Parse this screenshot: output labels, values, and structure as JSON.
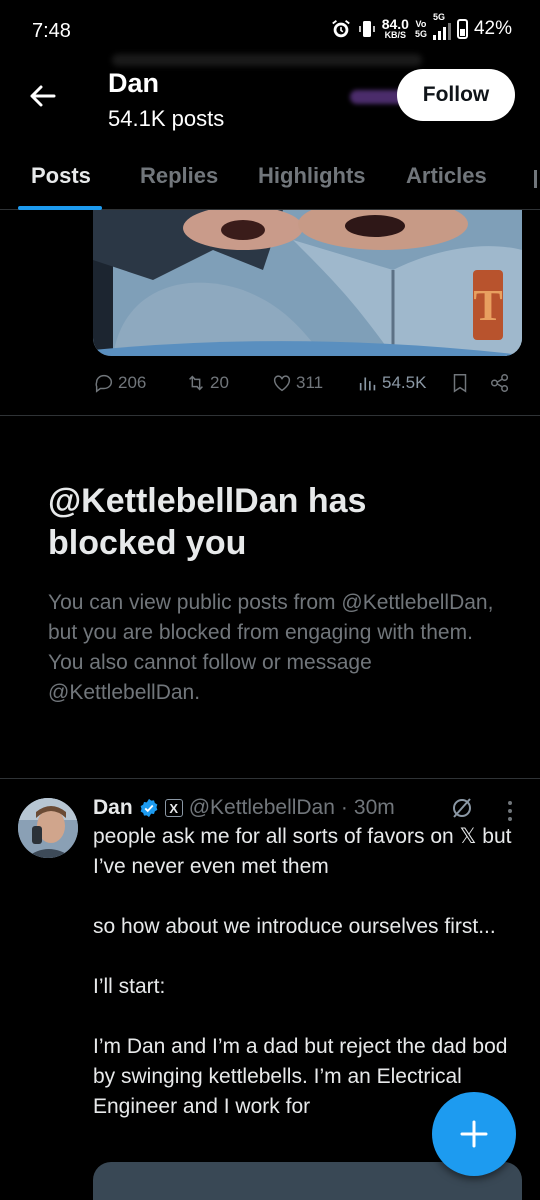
{
  "status_bar": {
    "time": "7:48",
    "net_speed": "84.0",
    "net_unit": "KB/S",
    "volte_top": "Vo",
    "volte_bottom": "5G",
    "network": "5G",
    "battery": "42%",
    "icons": [
      "alarm-icon",
      "vibrate-icon",
      "signal-icon",
      "battery-icon"
    ]
  },
  "header": {
    "name": "Dan",
    "posts": "54.1K posts",
    "follow_label": "Follow",
    "back_icon": "arrow-left-icon"
  },
  "tabs": [
    {
      "label": "Posts",
      "active": true
    },
    {
      "label": "Replies",
      "active": false
    },
    {
      "label": "Highlights",
      "active": false
    },
    {
      "label": "Articles",
      "active": false
    }
  ],
  "post_actions": {
    "replies": "206",
    "reposts": "20",
    "likes": "311",
    "views": "54.5K"
  },
  "blocked": {
    "title": "@KettlebellDan has blocked you",
    "body": "You can view public posts from @KettlebellDan, but you are blocked from engaging with them. You also cannot follow or message @KettlebellDan."
  },
  "tweet": {
    "name": "Dan",
    "affiliate_badge": "X",
    "handle": "@KettlebellDan",
    "separator": "·",
    "time": "30m",
    "text": "people ask me for all sorts of favors on 𝕏 but I’ve never even met them\n\nso how about we introduce ourselves first...\n\nI’ll start:\n\nI’m Dan and I’m a dad but reject the dad bod by swinging kettlebells. I’m an Electrical Engineer and I work for"
  },
  "colors": {
    "accent": "#1d9bf0",
    "background": "#000000",
    "text_primary": "#e7e9ea",
    "text_secondary": "#71767b",
    "divider": "#2f3336"
  }
}
